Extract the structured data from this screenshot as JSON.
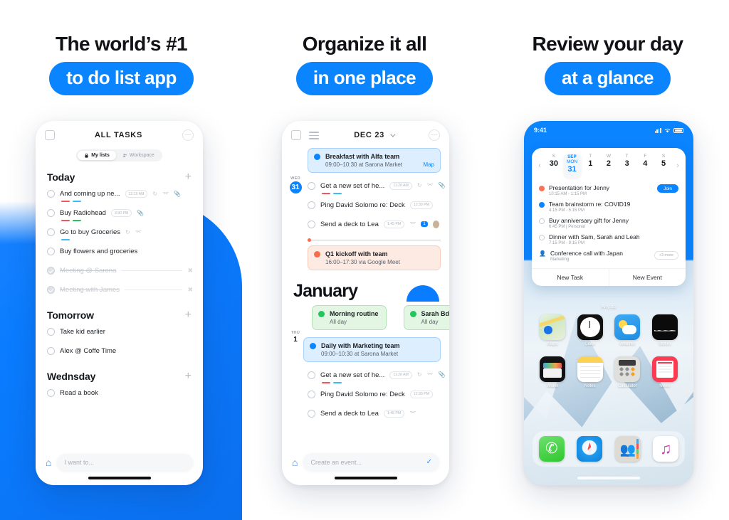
{
  "panels": [
    {
      "headline": "The world’s #1",
      "pill": "to do list app"
    },
    {
      "headline": "Organize it all",
      "pill": "in one place"
    },
    {
      "headline": "Review your day",
      "pill": "at a glance"
    }
  ],
  "colors": {
    "accent": "#0A84FF",
    "red": "#F96B4D",
    "green": "#22C55E",
    "text": "#15181C"
  },
  "screen1": {
    "header": {
      "title": "ALL TASKS",
      "menu_icon": "more-icon",
      "checkbox_icon": "select-icon"
    },
    "segments": [
      {
        "label": "My lists",
        "icon": "lock-icon",
        "selected": true
      },
      {
        "label": "Workspace",
        "icon": "people-icon",
        "selected": false
      }
    ],
    "sections": [
      {
        "title": "Today",
        "add_label": "+",
        "tasks": [
          {
            "text": "And coming up ne...",
            "badge": "12:15 AM",
            "icons": [
              "repeat-icon",
              "subtask-icon",
              "attachment-icon"
            ],
            "tags": [
              "#F2555A",
              "#38BDF8"
            ],
            "done": false
          },
          {
            "text": "Buy Radiohead",
            "badge": "3:30 PM",
            "icons": [
              "attachment-icon"
            ],
            "tags": [
              "#F2555A",
              "#22C55E"
            ],
            "done": false
          },
          {
            "text": "Go to buy Groceries",
            "badge": "",
            "icons": [
              "repeat-icon",
              "subtask-icon"
            ],
            "tags": [
              "#38BDF8"
            ],
            "done": false
          },
          {
            "text": "Buy flowers and groceries",
            "badge": "",
            "icons": [],
            "tags": [],
            "done": false
          },
          {
            "text": "Meeting @ Sarona",
            "badge": "",
            "icons": [
              "close-icon"
            ],
            "tags": [],
            "done": true
          },
          {
            "text": "Meeting with James",
            "badge": "",
            "icons": [
              "close-icon"
            ],
            "tags": [],
            "done": true
          }
        ]
      },
      {
        "title": "Tomorrow",
        "add_label": "+",
        "tasks": [
          {
            "text": "Take kid earlier",
            "badge": "",
            "icons": [],
            "tags": [],
            "done": false
          },
          {
            "text": "Alex @ Coffe Time",
            "badge": "",
            "icons": [],
            "tags": [],
            "done": false
          }
        ]
      },
      {
        "title": "Wednsday",
        "add_label": "+",
        "tasks": [
          {
            "text": "Read a book",
            "badge": "",
            "icons": [],
            "tags": [],
            "done": false
          }
        ]
      }
    ],
    "bottom": {
      "home_icon": "home-icon",
      "input_placeholder": "I want to..."
    }
  },
  "screen2": {
    "header": {
      "title": "DEC 23",
      "chevron_icon": "chevron-down-icon",
      "menu_icon": "hamburger-icon",
      "more_icon": "more-icon"
    },
    "day1": {
      "weekday": "WED",
      "number": "31"
    },
    "day2": {
      "weekday": "THU",
      "number": "1"
    },
    "month_label": "January",
    "events_wed": [
      {
        "type": "event",
        "color": "blue",
        "title": "Breakfast with Alfa team",
        "sub": "09:00–10:30 at Sarona Market",
        "link": "Map"
      },
      {
        "type": "task",
        "text": "Get a new set of he...",
        "badge": "11:20 AM",
        "icons": [
          "repeat-icon",
          "subtask-icon",
          "attachment-icon"
        ],
        "tags": [
          "#F2555A",
          "#38BDF8"
        ]
      },
      {
        "type": "task",
        "text": "Ping David Solomo re: Deck",
        "badge": "12:30 PM",
        "icons": [],
        "tags": []
      },
      {
        "type": "task",
        "text": "Send a deck to Lea",
        "badge": "1:45 PM",
        "icons": [
          "subtask-icon",
          "comment-badge",
          "avatar"
        ],
        "tags": []
      },
      {
        "type": "event",
        "color": "red",
        "title": "Q1 kickoff with team",
        "sub": "16:00–17:30 via Google Meet",
        "link": ""
      }
    ],
    "events_thu": [
      {
        "type": "event",
        "color": "green",
        "title": "Morning routine",
        "sub": "All day",
        "link": ""
      },
      {
        "type": "event",
        "color": "green",
        "title": "Sarah Bday eve",
        "sub": "All day",
        "link": ""
      },
      {
        "type": "event",
        "color": "blue",
        "title": "Daily with Marketing team",
        "sub": "09:00–10:30 at Sarona Market",
        "link": ""
      },
      {
        "type": "task",
        "text": "Get a new set of he...",
        "badge": "11:20 AM",
        "icons": [
          "repeat-icon",
          "subtask-icon",
          "attachment-icon"
        ],
        "tags": [
          "#F2555A",
          "#38BDF8"
        ]
      },
      {
        "type": "task",
        "text": "Ping David Solomo re: Deck",
        "badge": "12:30 PM",
        "icons": [],
        "tags": []
      },
      {
        "type": "task",
        "text": "Send a deck to Lea",
        "badge": "1:45 PM",
        "icons": [
          "subtask-icon"
        ],
        "tags": []
      }
    ],
    "bottom": {
      "home_icon": "home-icon",
      "input_placeholder": "Create an event...",
      "check_icon": "check-circle-icon"
    }
  },
  "screen3": {
    "status_bar": {
      "time": "9:41",
      "signal_icon": "cellular-icon",
      "wifi_icon": "wifi-icon",
      "battery_icon": "battery-icon"
    },
    "widget": {
      "prev_icon": "chevron-left-icon",
      "next_icon": "chevron-right-icon",
      "days": [
        {
          "month": "",
          "letter": "S",
          "number": "30",
          "selected": false,
          "marks": ""
        },
        {
          "month": "SEP",
          "letter": "MON",
          "number": "31",
          "selected": true,
          "marks": "·"
        },
        {
          "month": "",
          "letter": "T",
          "number": "1",
          "selected": false,
          "marks": "··"
        },
        {
          "month": "",
          "letter": "W",
          "number": "2",
          "selected": false,
          "marks": ""
        },
        {
          "month": "",
          "letter": "T",
          "number": "3",
          "selected": false,
          "marks": "·"
        },
        {
          "month": "",
          "letter": "F",
          "number": "4",
          "selected": false,
          "marks": ""
        },
        {
          "month": "",
          "letter": "S",
          "number": "5",
          "selected": false,
          "marks": ""
        }
      ],
      "events": [
        {
          "dot": "r",
          "title": "Presentation for Jenny",
          "sub": "10:15 AM - 1:15 PM",
          "action": "Join",
          "more": ""
        },
        {
          "dot": "b",
          "title": "Team brainstorm re: COVID19",
          "sub": "4:15 PM - 5:15 PM",
          "action": "",
          "more": ""
        },
        {
          "dot": "o",
          "title": "Buy anniversary gift for Jenny",
          "sub": "6:45 PM | Personal",
          "action": "",
          "more": ""
        },
        {
          "dot": "o",
          "title": "Dinner with Sam, Sarah and Leah",
          "sub": "7:15 PM - 9:15 PM",
          "action": "",
          "more": ""
        },
        {
          "dot": "p",
          "title": "Conference call with Japan",
          "sub": "Marketing",
          "action": "",
          "more": "+3 more"
        }
      ],
      "footer": [
        "New Task",
        "New Event"
      ]
    },
    "widget_name": "Any.do",
    "apps": [
      {
        "name": "Maps",
        "icon": "maps-icon"
      },
      {
        "name": "Clock",
        "icon": "clock-icon"
      },
      {
        "name": "Weather",
        "icon": "weather-icon"
      },
      {
        "name": "Stocks",
        "icon": "stocks-icon"
      },
      {
        "name": "Wallet",
        "icon": "wallet-icon"
      },
      {
        "name": "Notes",
        "icon": "notes-icon"
      },
      {
        "name": "Calculator",
        "icon": "calculator-icon"
      },
      {
        "name": "News",
        "icon": "news-icon"
      }
    ],
    "dock": [
      {
        "name": "Phone",
        "icon": "phone-icon"
      },
      {
        "name": "Safari",
        "icon": "safari-icon"
      },
      {
        "name": "Contacts",
        "icon": "contacts-icon"
      },
      {
        "name": "Music",
        "icon": "music-icon"
      }
    ]
  }
}
